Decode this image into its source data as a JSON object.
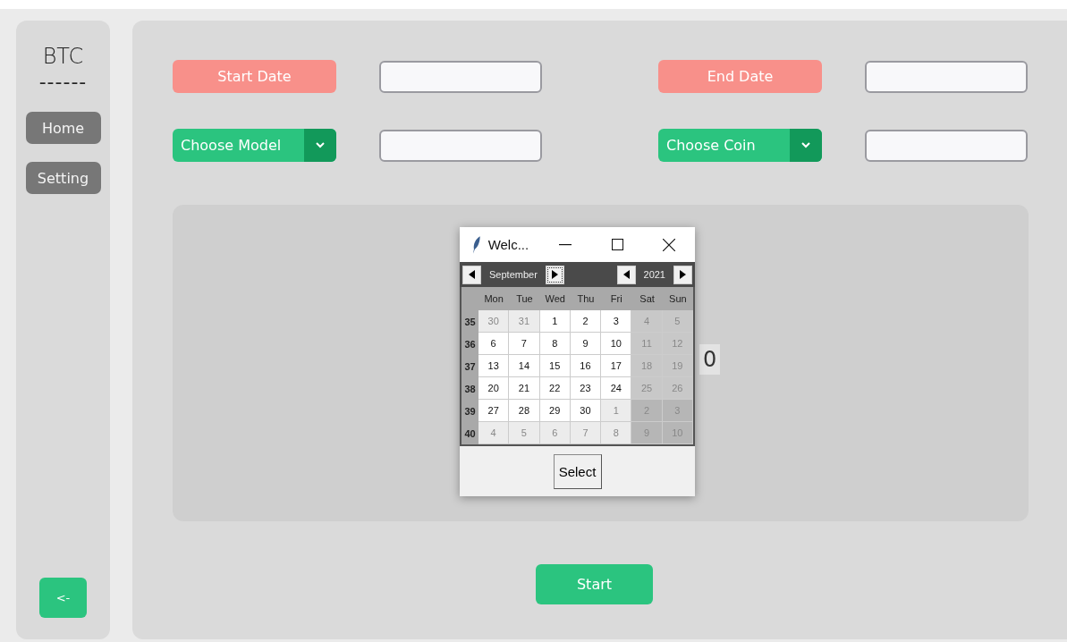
{
  "sidebar": {
    "title": "BTC",
    "divider": "------",
    "items": [
      {
        "label": "Home"
      },
      {
        "label": "Setting"
      }
    ],
    "back_button": "<-"
  },
  "form": {
    "rows": [
      {
        "left": {
          "label": "Start Date",
          "kind": "label"
        },
        "left_value": "",
        "right": {
          "label": "End Date",
          "kind": "label"
        },
        "right_value": ""
      },
      {
        "left": {
          "label": "Choose Model",
          "kind": "dropdown"
        },
        "left_value": "",
        "right": {
          "label": "Choose Coin",
          "kind": "dropdown"
        },
        "right_value": ""
      }
    ]
  },
  "output": {
    "text": "0"
  },
  "start_button": "Start",
  "dialog": {
    "title": "Welc...",
    "month": "September",
    "year": "2021",
    "weekdays": [
      "Mon",
      "Tue",
      "Wed",
      "Thu",
      "Fri",
      "Sat",
      "Sun"
    ],
    "weeks": [
      {
        "number": "35",
        "days": [
          {
            "day": "30",
            "other_month": true
          },
          {
            "day": "31",
            "other_month": true
          },
          {
            "day": "1",
            "other_month": false
          },
          {
            "day": "2",
            "other_month": false
          },
          {
            "day": "3",
            "other_month": false
          },
          {
            "day": "4",
            "other_month": false
          },
          {
            "day": "5",
            "other_month": false
          }
        ]
      },
      {
        "number": "36",
        "days": [
          {
            "day": "6",
            "other_month": false
          },
          {
            "day": "7",
            "other_month": false
          },
          {
            "day": "8",
            "other_month": false
          },
          {
            "day": "9",
            "other_month": false
          },
          {
            "day": "10",
            "other_month": false
          },
          {
            "day": "11",
            "other_month": false
          },
          {
            "day": "12",
            "other_month": false
          }
        ]
      },
      {
        "number": "37",
        "days": [
          {
            "day": "13",
            "other_month": false
          },
          {
            "day": "14",
            "other_month": false
          },
          {
            "day": "15",
            "other_month": false
          },
          {
            "day": "16",
            "other_month": false
          },
          {
            "day": "17",
            "other_month": false
          },
          {
            "day": "18",
            "other_month": false
          },
          {
            "day": "19",
            "other_month": false
          }
        ]
      },
      {
        "number": "38",
        "days": [
          {
            "day": "20",
            "other_month": false
          },
          {
            "day": "21",
            "other_month": false
          },
          {
            "day": "22",
            "other_month": false
          },
          {
            "day": "23",
            "other_month": false
          },
          {
            "day": "24",
            "other_month": false
          },
          {
            "day": "25",
            "other_month": false
          },
          {
            "day": "26",
            "other_month": false
          }
        ]
      },
      {
        "number": "39",
        "days": [
          {
            "day": "27",
            "other_month": false
          },
          {
            "day": "28",
            "other_month": false
          },
          {
            "day": "29",
            "other_month": false
          },
          {
            "day": "30",
            "other_month": false
          },
          {
            "day": "1",
            "other_month": true
          },
          {
            "day": "2",
            "other_month": true
          },
          {
            "day": "3",
            "other_month": true
          }
        ]
      },
      {
        "number": "40",
        "days": [
          {
            "day": "4",
            "other_month": true
          },
          {
            "day": "5",
            "other_month": true
          },
          {
            "day": "6",
            "other_month": true
          },
          {
            "day": "7",
            "other_month": true
          },
          {
            "day": "8",
            "other_month": true
          },
          {
            "day": "9",
            "other_month": true
          },
          {
            "day": "10",
            "other_month": true
          }
        ]
      }
    ],
    "select_button": "Select"
  }
}
